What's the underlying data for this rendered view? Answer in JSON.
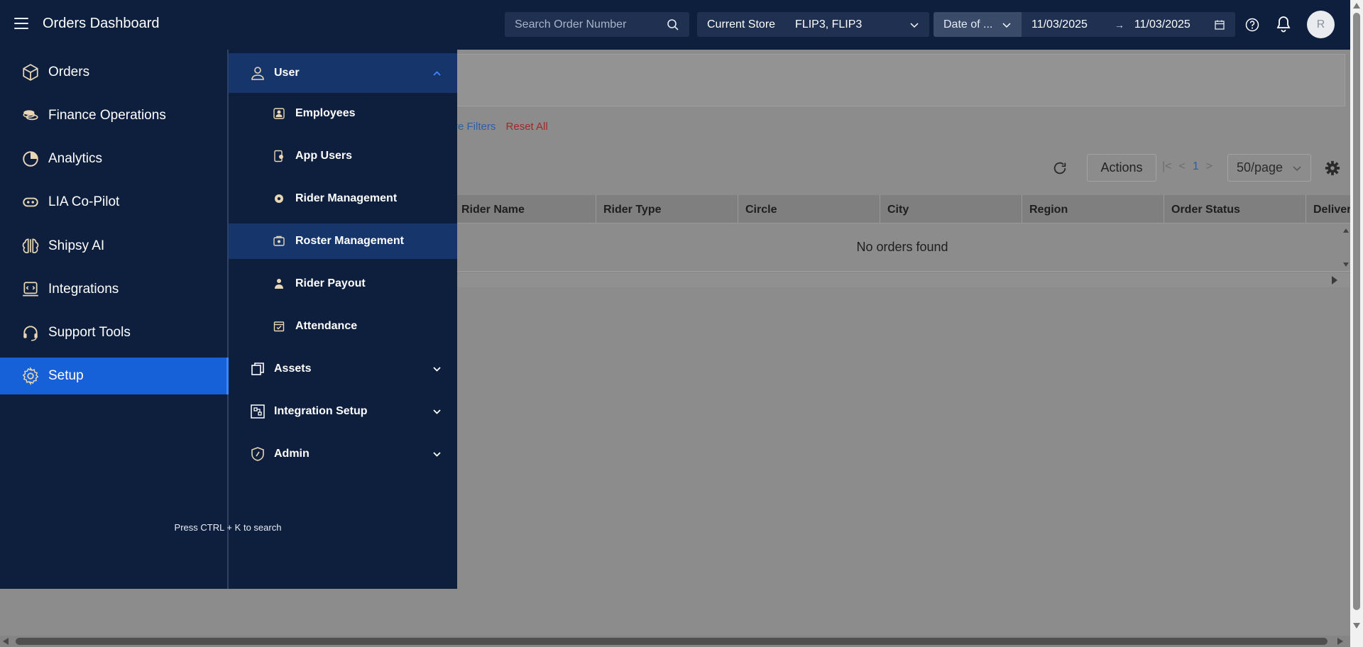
{
  "header": {
    "title": "Orders Dashboard",
    "search_placeholder": "Search Order Number",
    "store_label": "Current Store",
    "store_value": "FLIP3, FLIP3",
    "date_type": "Date of ...",
    "date_from": "11/03/2025",
    "date_to": "11/03/2025",
    "avatar_initial": "R"
  },
  "sidebar": {
    "items": [
      {
        "label": "Orders",
        "icon": "box-icon"
      },
      {
        "label": "Finance Operations",
        "icon": "coins-icon"
      },
      {
        "label": "Analytics",
        "icon": "pie-chart-icon"
      },
      {
        "label": "LIA Co-Pilot",
        "icon": "copilot-icon"
      },
      {
        "label": "Shipsy AI",
        "icon": "brain-icon"
      },
      {
        "label": "Integrations",
        "icon": "integration-icon"
      },
      {
        "label": "Support Tools",
        "icon": "headset-icon"
      },
      {
        "label": "Setup",
        "icon": "gear-icon",
        "active": true
      }
    ],
    "search_hint": "Press CTRL + K to search"
  },
  "submenu": {
    "user_group": "User",
    "user_items": [
      {
        "label": "Employees",
        "icon": "employees-icon"
      },
      {
        "label": "App Users",
        "icon": "app-users-icon"
      },
      {
        "label": "Rider Management",
        "icon": "rider-icon"
      },
      {
        "label": "Roster Management",
        "icon": "roster-icon"
      },
      {
        "label": "Rider Payout",
        "icon": "payout-icon"
      },
      {
        "label": "Attendance",
        "icon": "attendance-icon"
      }
    ],
    "assets": "Assets",
    "integration_setup": "Integration Setup",
    "admin": "Admin"
  },
  "page": {
    "more_filters": "re Filters",
    "reset_all": "Reset All",
    "actions": "Actions",
    "current_page": "1",
    "per_page": "50/page",
    "columns": [
      "Rider Name",
      "Rider Type",
      "Circle",
      "City",
      "Region",
      "Order Status",
      "Deliver"
    ],
    "empty_message": "No orders found"
  },
  "colors": {
    "nav_bg": "#0e1f3d",
    "active": "#1660d8",
    "submenu_open": "#16366b"
  }
}
